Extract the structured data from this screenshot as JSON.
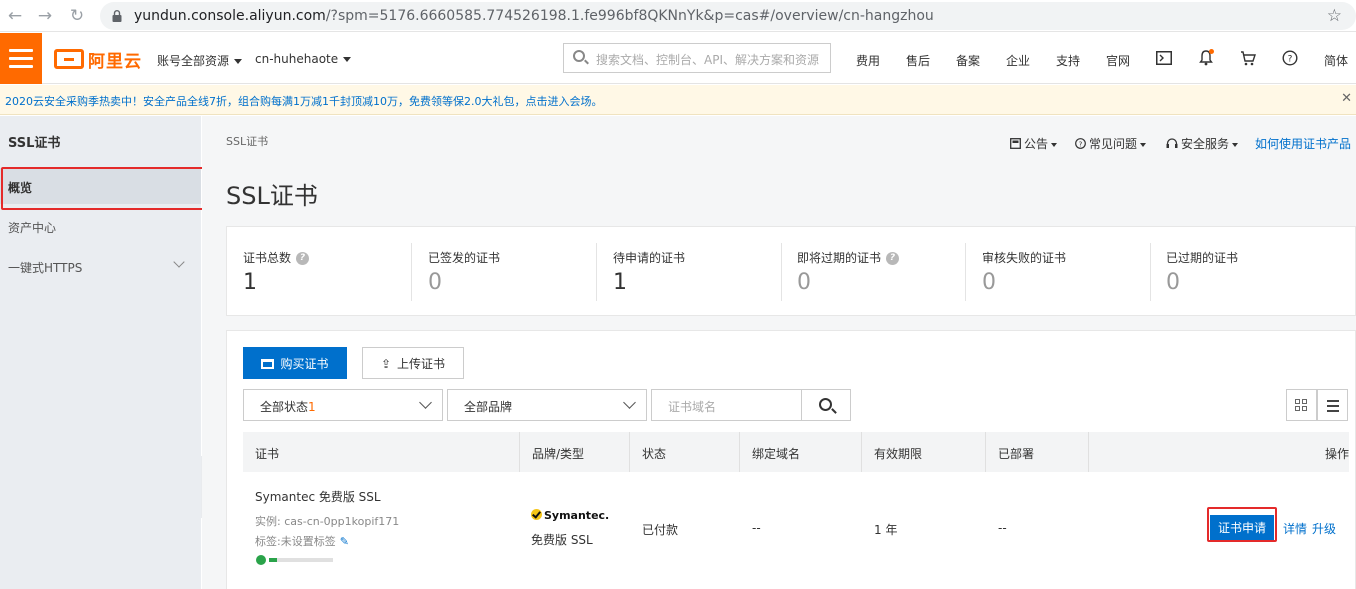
{
  "browser": {
    "url_host": "yundun.console.aliyun.com",
    "url_path": "/?spm=5176.6660585.774526198.1.fe996bf8QKNnYk&p=cas#/overview/cn-hangzhou"
  },
  "topnav": {
    "logo_text": "阿里云",
    "account_scope": "账号全部资源",
    "region": "cn-huhehaote",
    "search_placeholder": "搜索文档、控制台、API、解决方案和资源",
    "links": [
      "费用",
      "售后",
      "备案",
      "企业",
      "支持",
      "官网"
    ],
    "lang": "简体"
  },
  "promo": {
    "text": "2020云安全采购季热卖中！安全产品全线7折，组合购每满1万减1千封顶减10万，免费领等保2.0大礼包，点击进入会场。"
  },
  "sidebar": {
    "title": "SSL证书",
    "items": [
      {
        "label": "概览"
      },
      {
        "label": "资产中心"
      },
      {
        "label": "一键式HTTPS"
      }
    ]
  },
  "main": {
    "breadcrumb": "SSL证书",
    "title": "SSL证书",
    "help": {
      "announcement": "公告",
      "faq": "常见问题",
      "security_service": "安全服务",
      "howto": "如何使用证书产品"
    },
    "stats": [
      {
        "label": "证书总数",
        "value": "1",
        "help": true
      },
      {
        "label": "已签发的证书",
        "value": "0"
      },
      {
        "label": "待申请的证书",
        "value": "1"
      },
      {
        "label": "即将过期的证书",
        "value": "0",
        "help": true
      },
      {
        "label": "审核失败的证书",
        "value": "0"
      },
      {
        "label": "已过期的证书",
        "value": "0"
      }
    ],
    "buy_button": "购买证书",
    "upload_button": "上传证书",
    "status_filter": "全部状态",
    "status_count": "1",
    "brand_filter": "全部品牌",
    "domain_placeholder": "证书域名",
    "table": {
      "headers": [
        "证书",
        "品牌/类型",
        "状态",
        "绑定域名",
        "有效期限",
        "已部署",
        "操作"
      ],
      "row": {
        "name": "Symantec 免费版 SSL",
        "instance": "实例: cas-cn-0pp1kopif171",
        "tags": "标签:未设置标签",
        "brand_logo": "Symantec.",
        "brand_type": "免费版 SSL",
        "status": "已付款",
        "domain": "--",
        "validity": "1 年",
        "deployed": "--",
        "security_level": 0.12,
        "actions": {
          "apply": "证书申请",
          "detail": "详情",
          "upgrade": "升级"
        }
      }
    }
  }
}
